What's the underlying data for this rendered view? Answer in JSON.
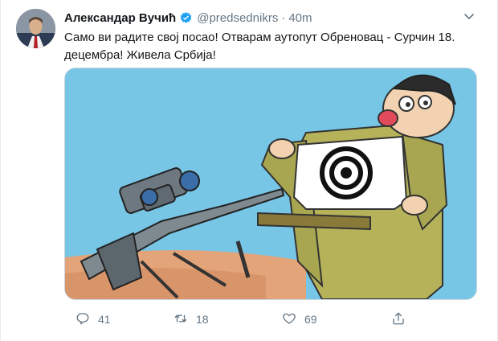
{
  "tweet": {
    "author_name": "Александар Вучић",
    "handle": "@predsednikrs",
    "separator": "·",
    "time": "40m",
    "text_line1": "Само ви радите свој посао! Отварам аутопут Обреновац - Сурчин 18.",
    "text_line2": "децембра! Живела Србија!"
  },
  "actions": {
    "reply_count": "41",
    "retweet_count": "18",
    "like_count": "69"
  },
  "colors": {
    "verified": "#1da1f2",
    "muted": "#657786",
    "image_sky": "#77c6e6"
  },
  "icons": [
    "verified-icon",
    "chevron-down-icon",
    "reply-icon",
    "retweet-icon",
    "like-icon",
    "share-icon"
  ]
}
